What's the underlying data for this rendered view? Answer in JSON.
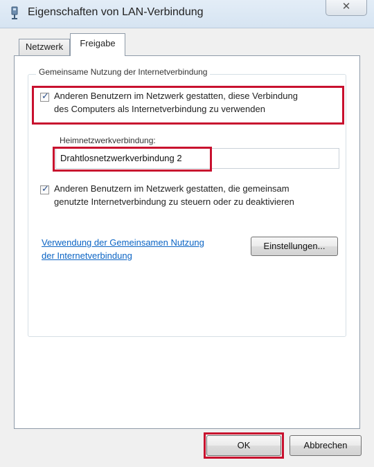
{
  "window": {
    "title": "Eigenschaften von LAN-Verbindung",
    "close_symbol": "✕",
    "title_icon": "network-adapter-icon"
  },
  "tabs": [
    {
      "label": "Netzwerk",
      "selected": false
    },
    {
      "label": "Freigabe",
      "selected": true
    }
  ],
  "sharing": {
    "group_label": "Gemeinsame Nutzung der Internetverbindung",
    "allow_sharing": {
      "checked": true,
      "line1": "Anderen Benutzern im Netzwerk gestatten, diese Verbindung",
      "line2": "des Computers als Internetverbindung zu verwenden"
    },
    "home_network": {
      "label": "Heimnetzwerkverbindung:",
      "value": "Drahtlosnetzwerkverbindung 2"
    },
    "allow_control": {
      "checked": true,
      "line1": "Anderen Benutzern im Netzwerk gestatten, die gemeinsam",
      "line2": "genutzte Internetverbindung zu steuern oder zu deaktivieren"
    },
    "help_link": {
      "line1": "Verwendung der Gemeinsamen Nutzung",
      "line2": "der Internetverbindung"
    },
    "settings_button": "Einstellungen..."
  },
  "footer": {
    "ok_label": "OK",
    "cancel_label": "Abbrechen"
  },
  "highlight_color": "#c8102e",
  "link_color": "#0b64c4"
}
